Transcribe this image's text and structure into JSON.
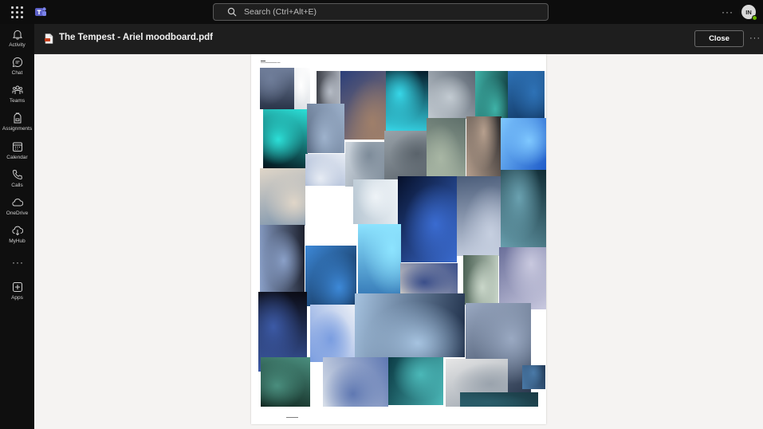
{
  "topbar": {
    "search_placeholder": "Search (Ctrl+Alt+E)",
    "avatar_initials": "IN"
  },
  "rail": {
    "items": [
      {
        "label": "Activity"
      },
      {
        "label": "Chat"
      },
      {
        "label": "Teams"
      },
      {
        "label": "Assignments"
      },
      {
        "label": "Calendar"
      },
      {
        "label": "Calls"
      },
      {
        "label": "OneDrive"
      },
      {
        "label": "MyHub"
      },
      {
        "label": "Apps"
      }
    ]
  },
  "header": {
    "file_title": "The Tempest - Ariel moodboard.pdf",
    "close_label": "Close"
  },
  "colors": {
    "accent": "#6264a7",
    "presence": "#6bb700"
  },
  "moodboard": {
    "tiles": [
      {
        "c": "#2a3448",
        "g": "#6f7d99"
      },
      {
        "c": "#d8dde2",
        "g": "#ffffff"
      },
      {
        "c": "#3a3d45",
        "g": "#b6bcc6"
      },
      {
        "c": "#2b3f7a",
        "g": "#9f7f6a"
      },
      {
        "c": "#061c2a",
        "g": "#37d7e8"
      },
      {
        "c": "#5a6470",
        "g": "#c3cbd2"
      },
      {
        "c": "#0a2a2e",
        "g": "#3fb3a8"
      },
      {
        "c": "#08254a",
        "g": "#2e72b6"
      },
      {
        "c": "#03121a",
        "g": "#2ce0d8"
      },
      {
        "c": "#5c6d86",
        "g": "#9eb2cc"
      },
      {
        "c": "#cfd7df",
        "g": "#7d8b99"
      },
      {
        "c": "#9aa3aa",
        "g": "#5a636b"
      },
      {
        "c": "#5e6f6a",
        "g": "#a8b6a4"
      },
      {
        "c": "#2b2a2c",
        "g": "#b7a08e"
      },
      {
        "c": "#1d5ac8",
        "g": "#7fc8ff"
      },
      {
        "c": "#7d95ad",
        "g": "#e0d6c8"
      },
      {
        "c": "#9fb0cf",
        "g": "#e7ecf4"
      },
      {
        "c": "#b7c6d2",
        "g": "#eef3f7"
      },
      {
        "c": "#06102a",
        "g": "#3a6bd0"
      },
      {
        "c": "#4b5d7a",
        "g": "#c6cfe0"
      },
      {
        "c": "#0f2a33",
        "g": "#6aa1b0"
      },
      {
        "c": "#1b1f2c",
        "g": "#8aa0c8"
      },
      {
        "c": "#0a1f3a",
        "g": "#3d89d8"
      },
      {
        "c": "#2d6fb0",
        "g": "#8de4ff"
      },
      {
        "c": "#d6d2ca",
        "g": "#3a4e8a"
      },
      {
        "c": "#495f52",
        "g": "#c9d6c9"
      },
      {
        "c": "#6a6f9a",
        "g": "#c9c9df"
      },
      {
        "c": "#0a0a12",
        "g": "#3c5aa6"
      },
      {
        "c": "#eef1f6",
        "g": "#7a9de0"
      },
      {
        "c": "#1a2a44",
        "g": "#a6c3e0"
      },
      {
        "c": "#2c3a50",
        "g": "#9aa9c2"
      },
      {
        "c": "#10261f",
        "g": "#4a8e7e"
      },
      {
        "c": "#d8dfe9",
        "g": "#5f78b2"
      },
      {
        "c": "#0b3a44",
        "g": "#4bb8b8"
      },
      {
        "c": "#e6e6e6",
        "g": "#9aa3ad"
      },
      {
        "c": "#1a3a44",
        "g": "#2a5d6a"
      },
      {
        "c": "#233c5a",
        "g": "#4a7aa8"
      }
    ]
  }
}
